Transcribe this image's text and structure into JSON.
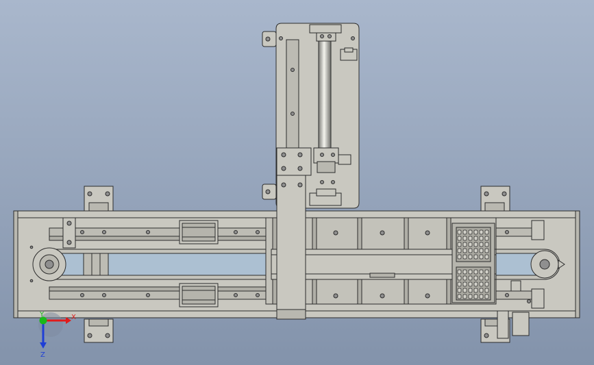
{
  "viewport": {
    "background_top": "#a9b7cc",
    "background_bottom": "#8393ab"
  },
  "colors": {
    "metal": "#c9c8c0",
    "metal_dark": "#a9a8a0",
    "outline": "#2b2b2b",
    "hole": "#8f8f8f"
  },
  "triad": {
    "x_label": "X",
    "y_label": "Y",
    "z_label": "Z",
    "x_color": "#e11b1b",
    "y_color": "#19b819",
    "z_color": "#1f3fd6"
  }
}
